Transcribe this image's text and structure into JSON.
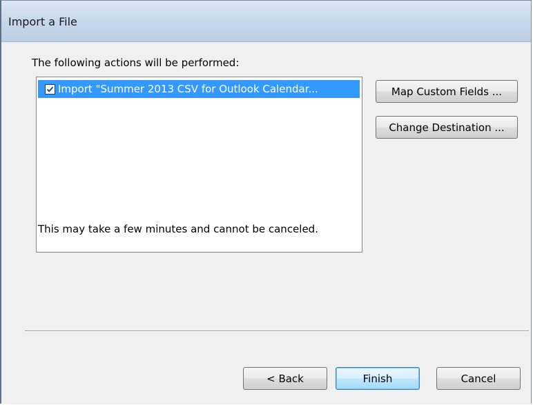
{
  "window": {
    "title": "Import a File"
  },
  "main": {
    "actions_label": "The following actions will be performed:",
    "actions": [
      {
        "label": "Import \"Summer 2013 CSV for Outlook Calendar...",
        "checked": true,
        "selected": true
      }
    ],
    "note": "This may take a few minutes and cannot be canceled."
  },
  "side_buttons": {
    "map_fields": "Map Custom Fields ...",
    "change_destination": "Change Destination ..."
  },
  "footer": {
    "back": "< Back",
    "finish": "Finish",
    "cancel": "Cancel"
  },
  "colors": {
    "selection": "#3399ff",
    "titlebar": "#c6d6ea",
    "dialog_bg": "#f0f0f0"
  },
  "icons": {
    "checkbox": "checkmark-icon"
  }
}
